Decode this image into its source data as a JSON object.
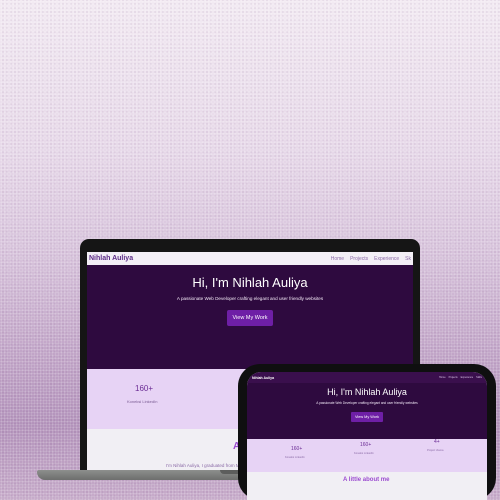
{
  "laptop": {
    "nav": {
      "brand": "Nihlah Auliya",
      "links": [
        "Home",
        "Projects",
        "Experience",
        "Sk"
      ]
    },
    "hero": {
      "title": "Hi, I'm Nihlah Auliya",
      "subtitle": "A passionate Web Developer crafting elegant and user friendly websites",
      "cta": "View My Work"
    },
    "stats": [
      {
        "value": "160+",
        "label": "Koneksi LinkedIn"
      }
    ],
    "about": {
      "title": "A li",
      "text": "I'm Nihlah Auliya, I graduated from Ma"
    }
  },
  "phone": {
    "nav": {
      "brand": "Nihlah Auliya",
      "links": [
        "Home",
        "Projects",
        "Experience",
        "Skills"
      ]
    },
    "hero": {
      "title": "Hi, I'm Nihlah Auliya",
      "subtitle": "A passionate Web Developer crafting elegant and user friendly websites",
      "cta": "View My Work"
    },
    "stats": [
      {
        "value": "160+",
        "label": "Koneksi LinkedIn"
      },
      {
        "value": "160+",
        "label": "Koneksi LinkedIn"
      },
      {
        "value": "4+",
        "label": "Project Utama"
      }
    ],
    "about": {
      "title": "A little about me"
    }
  },
  "colors": {
    "brand": "#5b2a86",
    "hero_bg": "#2e0a3f",
    "button": "#6e1fa6",
    "stats_bg": "#e7d3f5",
    "accent_text": "#9b4bd0"
  }
}
